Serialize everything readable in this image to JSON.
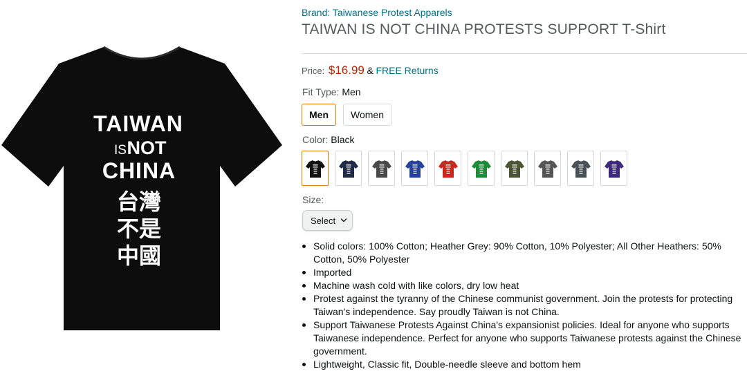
{
  "product": {
    "image": {
      "shirt_color": "#0d0d0d",
      "print_lines": [
        "TAIWAN",
        "IS",
        "NOT",
        "CHINA",
        "台灣",
        "不是",
        "中國"
      ]
    },
    "brand": "Brand: Taiwanese Protest Apparels",
    "title": "TAIWAN IS NOT CHINA PROTESTS SUPPORT T-Shirt",
    "price": {
      "label": "Price:",
      "value": "$16.99",
      "ampersand": "&",
      "returns": "FREE Returns"
    },
    "fit_type": {
      "label": "Fit Type:",
      "selected": "Men",
      "options": [
        "Men",
        "Women"
      ]
    },
    "color": {
      "label": "Color:",
      "selected": "Black",
      "swatches": [
        {
          "name": "Black",
          "hex": "#111111"
        },
        {
          "name": "Navy",
          "hex": "#1f2a44"
        },
        {
          "name": "Dark Heather",
          "hex": "#4a4a4a"
        },
        {
          "name": "Royal Blue",
          "hex": "#27409a"
        },
        {
          "name": "Red",
          "hex": "#c8291f"
        },
        {
          "name": "Kelly Green",
          "hex": "#1e8a3a"
        },
        {
          "name": "Olive",
          "hex": "#4b5536"
        },
        {
          "name": "Charcoal",
          "hex": "#555555"
        },
        {
          "name": "Slate",
          "hex": "#4a5058"
        },
        {
          "name": "Purple",
          "hex": "#3d2a7a"
        }
      ]
    },
    "size": {
      "label": "Size:",
      "select_value": "Select"
    },
    "bullets": [
      "Solid colors: 100% Cotton; Heather Grey: 90% Cotton, 10% Polyester; All Other Heathers: 50% Cotton, 50% Polyester",
      "Imported",
      "Machine wash cold with like colors, dry low heat",
      "Protest against the tyranny of the Chinese communist government. Join the protests for protecting Taiwan's independence. Say proudly Taiwan is not China.",
      "Support Taiwanese Protests Against China's expansionist policies. Ideal for anyone who supports Taiwanese independence. Perfect for anyone who supports Taiwanese protests against the Chinese government.",
      "Lightweight, Classic fit, Double-needle sleeve and bottom hem"
    ]
  }
}
